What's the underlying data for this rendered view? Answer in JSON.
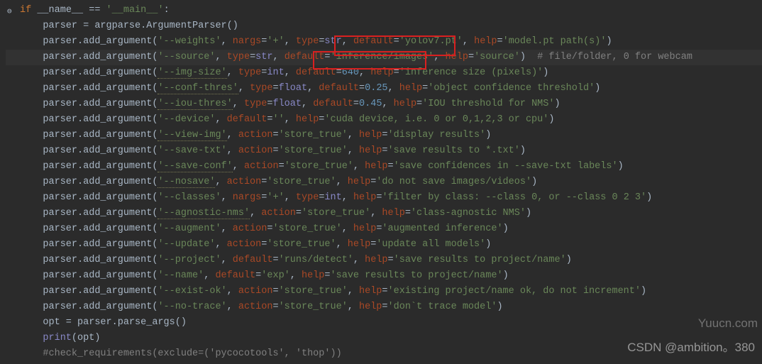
{
  "gutter_icon_glyph": "⊖",
  "lines": [
    {
      "type": "if_main",
      "indent": 0,
      "gutter": true,
      "parts": [
        {
          "cls": "kw",
          "t": "if "
        },
        {
          "cls": "ident",
          "t": "__name__ "
        },
        {
          "cls": "ident",
          "t": "== "
        },
        {
          "cls": "str",
          "t": "'__main__'"
        },
        {
          "cls": "ident",
          "t": ":"
        }
      ]
    },
    {
      "type": "assign",
      "indent": 1,
      "parts": [
        {
          "cls": "ident",
          "t": "parser = argparse.ArgumentParser()"
        }
      ]
    },
    {
      "type": "arg",
      "indent": 1,
      "parts": [
        {
          "cls": "ident",
          "t": "parser.add_argument("
        },
        {
          "cls": "str",
          "t": "'--weights'"
        },
        {
          "cls": "ident",
          "t": ", "
        },
        {
          "cls": "param",
          "t": "nargs"
        },
        {
          "cls": "ident",
          "t": "="
        },
        {
          "cls": "str",
          "t": "'+'"
        },
        {
          "cls": "ident",
          "t": ", "
        },
        {
          "cls": "param",
          "t": "type"
        },
        {
          "cls": "ident",
          "t": "="
        },
        {
          "cls": "builtin",
          "t": "str"
        },
        {
          "cls": "ident",
          "t": ", "
        },
        {
          "cls": "param",
          "t": "default"
        },
        {
          "cls": "ident",
          "t": "="
        },
        {
          "cls": "str",
          "t": "'yolov7.pt'"
        },
        {
          "cls": "ident",
          "t": ", "
        },
        {
          "cls": "param",
          "t": "help"
        },
        {
          "cls": "ident",
          "t": "="
        },
        {
          "cls": "str",
          "t": "'model.pt path(s)'"
        },
        {
          "cls": "ident",
          "t": ")"
        }
      ]
    },
    {
      "type": "arg",
      "indent": 1,
      "hl": true,
      "parts": [
        {
          "cls": "ident",
          "t": "parser.add_argument("
        },
        {
          "cls": "str",
          "t": "'--source'"
        },
        {
          "cls": "ident",
          "t": ", "
        },
        {
          "cls": "param",
          "t": "type"
        },
        {
          "cls": "ident",
          "t": "="
        },
        {
          "cls": "builtin",
          "t": "str"
        },
        {
          "cls": "ident",
          "t": ", "
        },
        {
          "cls": "param",
          "t": "default"
        },
        {
          "cls": "ident",
          "t": "="
        },
        {
          "cls": "str",
          "t": "'inference/images'"
        },
        {
          "cls": "ident",
          "t": ", "
        },
        {
          "cls": "param",
          "t": "help"
        },
        {
          "cls": "ident",
          "t": "="
        },
        {
          "cls": "str",
          "t": "'source'"
        },
        {
          "cls": "ident",
          "t": ")  "
        },
        {
          "cls": "comment",
          "t": "# file/folder, 0 for webcam"
        }
      ]
    },
    {
      "type": "arg",
      "indent": 1,
      "parts": [
        {
          "cls": "ident",
          "t": "parser.add_argument("
        },
        {
          "cls": "str typo",
          "t": "'--img-size'"
        },
        {
          "cls": "ident",
          "t": ", "
        },
        {
          "cls": "param",
          "t": "type"
        },
        {
          "cls": "ident",
          "t": "="
        },
        {
          "cls": "builtin",
          "t": "int"
        },
        {
          "cls": "ident",
          "t": ", "
        },
        {
          "cls": "param",
          "t": "default"
        },
        {
          "cls": "ident",
          "t": "="
        },
        {
          "cls": "num",
          "t": "640"
        },
        {
          "cls": "ident",
          "t": ", "
        },
        {
          "cls": "param",
          "t": "help"
        },
        {
          "cls": "ident",
          "t": "="
        },
        {
          "cls": "str",
          "t": "'inference size (pixels)'"
        },
        {
          "cls": "ident",
          "t": ")"
        }
      ]
    },
    {
      "type": "arg",
      "indent": 1,
      "parts": [
        {
          "cls": "ident",
          "t": "parser.add_argument("
        },
        {
          "cls": "str typo",
          "t": "'--conf-thres'"
        },
        {
          "cls": "ident",
          "t": ", "
        },
        {
          "cls": "param",
          "t": "type"
        },
        {
          "cls": "ident",
          "t": "="
        },
        {
          "cls": "builtin",
          "t": "float"
        },
        {
          "cls": "ident",
          "t": ", "
        },
        {
          "cls": "param",
          "t": "default"
        },
        {
          "cls": "ident",
          "t": "="
        },
        {
          "cls": "num",
          "t": "0.25"
        },
        {
          "cls": "ident",
          "t": ", "
        },
        {
          "cls": "param",
          "t": "help"
        },
        {
          "cls": "ident",
          "t": "="
        },
        {
          "cls": "str",
          "t": "'object confidence threshold'"
        },
        {
          "cls": "ident",
          "t": ")"
        }
      ]
    },
    {
      "type": "arg",
      "indent": 1,
      "parts": [
        {
          "cls": "ident",
          "t": "parser.add_argument("
        },
        {
          "cls": "str typo",
          "t": "'--iou-thres'"
        },
        {
          "cls": "ident",
          "t": ", "
        },
        {
          "cls": "param",
          "t": "type"
        },
        {
          "cls": "ident",
          "t": "="
        },
        {
          "cls": "builtin",
          "t": "float"
        },
        {
          "cls": "ident",
          "t": ", "
        },
        {
          "cls": "param",
          "t": "default"
        },
        {
          "cls": "ident",
          "t": "="
        },
        {
          "cls": "num",
          "t": "0.45"
        },
        {
          "cls": "ident",
          "t": ", "
        },
        {
          "cls": "param",
          "t": "help"
        },
        {
          "cls": "ident",
          "t": "="
        },
        {
          "cls": "str",
          "t": "'IOU threshold for NMS'"
        },
        {
          "cls": "ident",
          "t": ")"
        }
      ]
    },
    {
      "type": "arg",
      "indent": 1,
      "parts": [
        {
          "cls": "ident",
          "t": "parser.add_argument("
        },
        {
          "cls": "str",
          "t": "'--device'"
        },
        {
          "cls": "ident",
          "t": ", "
        },
        {
          "cls": "param",
          "t": "default"
        },
        {
          "cls": "ident",
          "t": "="
        },
        {
          "cls": "str",
          "t": "''"
        },
        {
          "cls": "ident",
          "t": ", "
        },
        {
          "cls": "param",
          "t": "help"
        },
        {
          "cls": "ident",
          "t": "="
        },
        {
          "cls": "str",
          "t": "'cuda device, i.e. 0 or 0,1,2,3 or cpu'"
        },
        {
          "cls": "ident",
          "t": ")"
        }
      ]
    },
    {
      "type": "arg",
      "indent": 1,
      "parts": [
        {
          "cls": "ident",
          "t": "parser.add_argument("
        },
        {
          "cls": "str typo",
          "t": "'--view-img'"
        },
        {
          "cls": "ident",
          "t": ", "
        },
        {
          "cls": "param",
          "t": "action"
        },
        {
          "cls": "ident",
          "t": "="
        },
        {
          "cls": "str",
          "t": "'store_true'"
        },
        {
          "cls": "ident",
          "t": ", "
        },
        {
          "cls": "param",
          "t": "help"
        },
        {
          "cls": "ident",
          "t": "="
        },
        {
          "cls": "str",
          "t": "'display results'"
        },
        {
          "cls": "ident",
          "t": ")"
        }
      ]
    },
    {
      "type": "arg",
      "indent": 1,
      "parts": [
        {
          "cls": "ident",
          "t": "parser.add_argument("
        },
        {
          "cls": "str",
          "t": "'--save-txt'"
        },
        {
          "cls": "ident",
          "t": ", "
        },
        {
          "cls": "param",
          "t": "action"
        },
        {
          "cls": "ident",
          "t": "="
        },
        {
          "cls": "str",
          "t": "'store_true'"
        },
        {
          "cls": "ident",
          "t": ", "
        },
        {
          "cls": "param",
          "t": "help"
        },
        {
          "cls": "ident",
          "t": "="
        },
        {
          "cls": "str",
          "t": "'save results to *.txt'"
        },
        {
          "cls": "ident",
          "t": ")"
        }
      ]
    },
    {
      "type": "arg",
      "indent": 1,
      "parts": [
        {
          "cls": "ident",
          "t": "parser.add_argument("
        },
        {
          "cls": "str typo",
          "t": "'--save-conf'"
        },
        {
          "cls": "ident",
          "t": ", "
        },
        {
          "cls": "param",
          "t": "action"
        },
        {
          "cls": "ident",
          "t": "="
        },
        {
          "cls": "str",
          "t": "'store_true'"
        },
        {
          "cls": "ident",
          "t": ", "
        },
        {
          "cls": "param",
          "t": "help"
        },
        {
          "cls": "ident",
          "t": "="
        },
        {
          "cls": "str",
          "t": "'save confidences in --save-txt labels'"
        },
        {
          "cls": "ident",
          "t": ")"
        }
      ]
    },
    {
      "type": "arg",
      "indent": 1,
      "parts": [
        {
          "cls": "ident",
          "t": "parser.add_argument("
        },
        {
          "cls": "str typo",
          "t": "'--nosave'"
        },
        {
          "cls": "ident",
          "t": ", "
        },
        {
          "cls": "param",
          "t": "action"
        },
        {
          "cls": "ident",
          "t": "="
        },
        {
          "cls": "str",
          "t": "'store_true'"
        },
        {
          "cls": "ident",
          "t": ", "
        },
        {
          "cls": "param",
          "t": "help"
        },
        {
          "cls": "ident",
          "t": "="
        },
        {
          "cls": "str",
          "t": "'do not save images/videos'"
        },
        {
          "cls": "ident",
          "t": ")"
        }
      ]
    },
    {
      "type": "arg",
      "indent": 1,
      "parts": [
        {
          "cls": "ident",
          "t": "parser.add_argument("
        },
        {
          "cls": "str",
          "t": "'--classes'"
        },
        {
          "cls": "ident",
          "t": ", "
        },
        {
          "cls": "param",
          "t": "nargs"
        },
        {
          "cls": "ident",
          "t": "="
        },
        {
          "cls": "str",
          "t": "'+'"
        },
        {
          "cls": "ident",
          "t": ", "
        },
        {
          "cls": "param",
          "t": "type"
        },
        {
          "cls": "ident",
          "t": "="
        },
        {
          "cls": "builtin",
          "t": "int"
        },
        {
          "cls": "ident",
          "t": ", "
        },
        {
          "cls": "param",
          "t": "help"
        },
        {
          "cls": "ident",
          "t": "="
        },
        {
          "cls": "str",
          "t": "'filter by class: --class 0, or --class 0 2 3'"
        },
        {
          "cls": "ident",
          "t": ")"
        }
      ]
    },
    {
      "type": "arg",
      "indent": 1,
      "parts": [
        {
          "cls": "ident",
          "t": "parser.add_argument("
        },
        {
          "cls": "str typo",
          "t": "'--agnostic-nms'"
        },
        {
          "cls": "ident",
          "t": ", "
        },
        {
          "cls": "param",
          "t": "action"
        },
        {
          "cls": "ident",
          "t": "="
        },
        {
          "cls": "str",
          "t": "'store_true'"
        },
        {
          "cls": "ident",
          "t": ", "
        },
        {
          "cls": "param",
          "t": "help"
        },
        {
          "cls": "ident",
          "t": "="
        },
        {
          "cls": "str",
          "t": "'class-agnostic NMS'"
        },
        {
          "cls": "ident",
          "t": ")"
        }
      ]
    },
    {
      "type": "arg",
      "indent": 1,
      "parts": [
        {
          "cls": "ident",
          "t": "parser.add_argument("
        },
        {
          "cls": "str",
          "t": "'--augment'"
        },
        {
          "cls": "ident",
          "t": ", "
        },
        {
          "cls": "param",
          "t": "action"
        },
        {
          "cls": "ident",
          "t": "="
        },
        {
          "cls": "str",
          "t": "'store_true'"
        },
        {
          "cls": "ident",
          "t": ", "
        },
        {
          "cls": "param",
          "t": "help"
        },
        {
          "cls": "ident",
          "t": "="
        },
        {
          "cls": "str",
          "t": "'augmented inference'"
        },
        {
          "cls": "ident",
          "t": ")"
        }
      ]
    },
    {
      "type": "arg",
      "indent": 1,
      "parts": [
        {
          "cls": "ident",
          "t": "parser.add_argument("
        },
        {
          "cls": "str",
          "t": "'--update'"
        },
        {
          "cls": "ident",
          "t": ", "
        },
        {
          "cls": "param",
          "t": "action"
        },
        {
          "cls": "ident",
          "t": "="
        },
        {
          "cls": "str",
          "t": "'store_true'"
        },
        {
          "cls": "ident",
          "t": ", "
        },
        {
          "cls": "param",
          "t": "help"
        },
        {
          "cls": "ident",
          "t": "="
        },
        {
          "cls": "str",
          "t": "'update all models'"
        },
        {
          "cls": "ident",
          "t": ")"
        }
      ]
    },
    {
      "type": "arg",
      "indent": 1,
      "parts": [
        {
          "cls": "ident",
          "t": "parser.add_argument("
        },
        {
          "cls": "str",
          "t": "'--project'"
        },
        {
          "cls": "ident",
          "t": ", "
        },
        {
          "cls": "param",
          "t": "default"
        },
        {
          "cls": "ident",
          "t": "="
        },
        {
          "cls": "str",
          "t": "'runs/detect'"
        },
        {
          "cls": "ident",
          "t": ", "
        },
        {
          "cls": "param",
          "t": "help"
        },
        {
          "cls": "ident",
          "t": "="
        },
        {
          "cls": "str",
          "t": "'save results to project/name'"
        },
        {
          "cls": "ident",
          "t": ")"
        }
      ]
    },
    {
      "type": "arg",
      "indent": 1,
      "parts": [
        {
          "cls": "ident",
          "t": "parser.add_argument("
        },
        {
          "cls": "str",
          "t": "'--name'"
        },
        {
          "cls": "ident",
          "t": ", "
        },
        {
          "cls": "param",
          "t": "default"
        },
        {
          "cls": "ident",
          "t": "="
        },
        {
          "cls": "str",
          "t": "'exp'"
        },
        {
          "cls": "ident",
          "t": ", "
        },
        {
          "cls": "param",
          "t": "help"
        },
        {
          "cls": "ident",
          "t": "="
        },
        {
          "cls": "str",
          "t": "'save results to project/name'"
        },
        {
          "cls": "ident",
          "t": ")"
        }
      ]
    },
    {
      "type": "arg",
      "indent": 1,
      "parts": [
        {
          "cls": "ident",
          "t": "parser.add_argument("
        },
        {
          "cls": "str",
          "t": "'--exist-ok'"
        },
        {
          "cls": "ident",
          "t": ", "
        },
        {
          "cls": "param",
          "t": "action"
        },
        {
          "cls": "ident",
          "t": "="
        },
        {
          "cls": "str",
          "t": "'store_true'"
        },
        {
          "cls": "ident",
          "t": ", "
        },
        {
          "cls": "param",
          "t": "help"
        },
        {
          "cls": "ident",
          "t": "="
        },
        {
          "cls": "str",
          "t": "'existing project/name ok, do not increment'"
        },
        {
          "cls": "ident",
          "t": ")"
        }
      ]
    },
    {
      "type": "arg",
      "indent": 1,
      "parts": [
        {
          "cls": "ident",
          "t": "parser.add_argument("
        },
        {
          "cls": "str",
          "t": "'--no-trace'"
        },
        {
          "cls": "ident",
          "t": ", "
        },
        {
          "cls": "param",
          "t": "action"
        },
        {
          "cls": "ident",
          "t": "="
        },
        {
          "cls": "str",
          "t": "'store_true'"
        },
        {
          "cls": "ident",
          "t": ", "
        },
        {
          "cls": "param",
          "t": "help"
        },
        {
          "cls": "ident",
          "t": "="
        },
        {
          "cls": "str",
          "t": "'don`t trace model'"
        },
        {
          "cls": "ident",
          "t": ")"
        }
      ]
    },
    {
      "type": "assign",
      "indent": 1,
      "parts": [
        {
          "cls": "ident",
          "t": "opt = parser.parse_args()"
        }
      ]
    },
    {
      "type": "call",
      "indent": 1,
      "parts": [
        {
          "cls": "builtin",
          "t": "print"
        },
        {
          "cls": "ident",
          "t": "(opt)"
        }
      ]
    },
    {
      "type": "comment",
      "indent": 1,
      "parts": [
        {
          "cls": "comment",
          "t": "#check_requirements(exclude=('pycocotools', 'thop'))"
        }
      ]
    }
  ],
  "watermark_right": "Yuucn.com",
  "watermark_bottom": "CSDN @ambition。380"
}
